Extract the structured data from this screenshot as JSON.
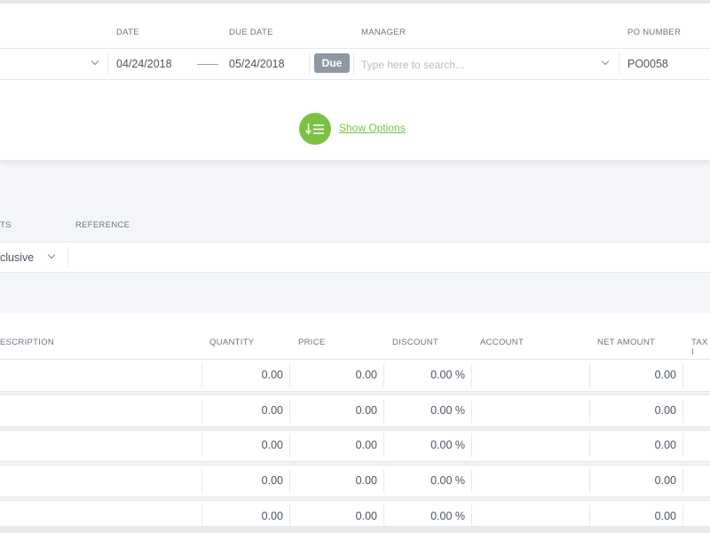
{
  "header": {
    "date_label": "DATE",
    "due_date_label": "DUE DATE",
    "manager_label": "MANAGER",
    "po_number_label": "PO NUMBER",
    "date_value": "04/24/2018",
    "due_date_value": "05/24/2018",
    "due_badge": "Due",
    "manager_placeholder": "Type here to search...",
    "po_number_value": "PO0058"
  },
  "options": {
    "show_options_label": "Show Options"
  },
  "tax_section": {
    "tax_label_partial": "TS",
    "reference_label": "REFERENCE",
    "tax_value_partial": "clusive",
    "reference_value": ""
  },
  "table": {
    "columns": {
      "description": "ESCRIPTION",
      "quantity": "QUANTITY",
      "price": "PRICE",
      "discount": "DISCOUNT",
      "account": "ACCOUNT",
      "net_amount": "NET AMOUNT",
      "tax": "TAX I"
    },
    "rows": [
      {
        "quantity": "0.00",
        "price": "0.00",
        "discount": "0.00 %",
        "net_amount": "0.00"
      },
      {
        "quantity": "0.00",
        "price": "0.00",
        "discount": "0.00 %",
        "net_amount": "0.00"
      },
      {
        "quantity": "0.00",
        "price": "0.00",
        "discount": "0.00 %",
        "net_amount": "0.00"
      },
      {
        "quantity": "0.00",
        "price": "0.00",
        "discount": "0.00 %",
        "net_amount": "0.00"
      },
      {
        "quantity": "0.00",
        "price": "0.00",
        "discount": "0.00 %",
        "net_amount": "0.00"
      }
    ]
  },
  "colors": {
    "accent_green": "#7cc242",
    "badge_gray": "#8f99a5",
    "background": "#f3f5f8"
  },
  "icons": {
    "options_icon": "sort-list-icon",
    "dropdown_icon": "chevron-down-icon"
  }
}
